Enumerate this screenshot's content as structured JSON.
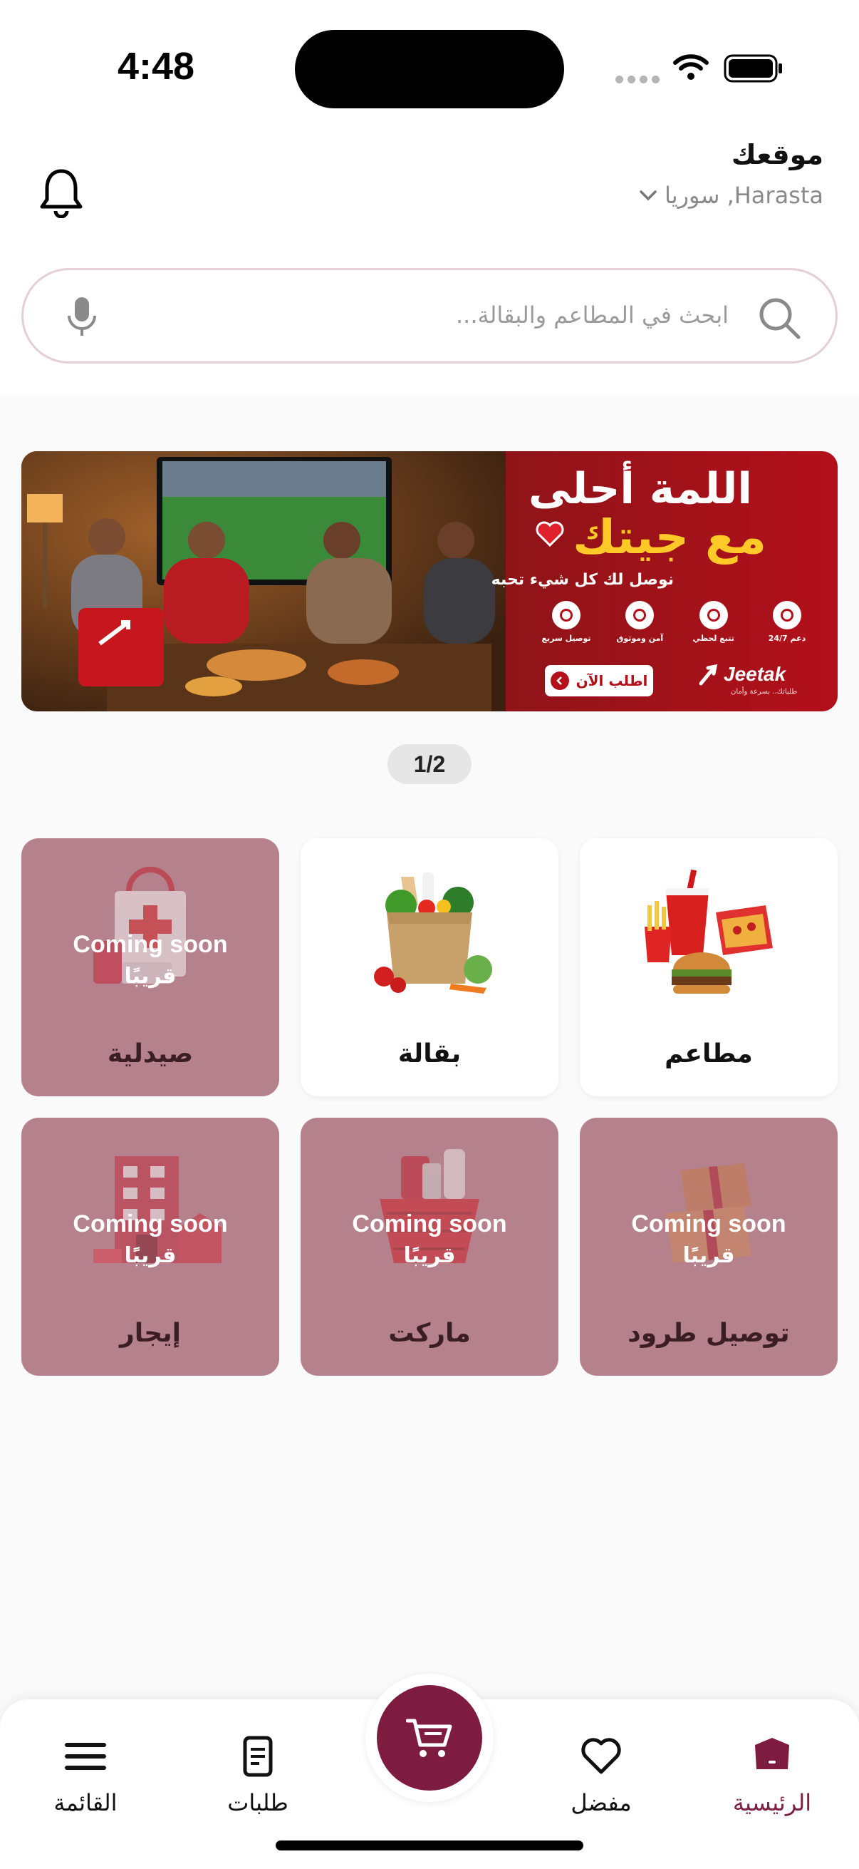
{
  "status_bar": {
    "time": "4:48"
  },
  "header": {
    "location_title": "موقعك",
    "location_value": "Harasta, سوريا"
  },
  "search": {
    "placeholder": "ابحث في المطاعم والبقالة..."
  },
  "banner": {
    "headline_line1": "اللمة أحلى",
    "headline_line2": "مع جيتك",
    "subtitle": "نوصل لك كل شيء تحبه",
    "features": [
      "دعم 24/7",
      "تتبع لحظي",
      "آمن وموثوق",
      "توصيل سريع"
    ],
    "cta_label": "اطلب الآن",
    "brand_name": "Jeetak",
    "brand_tagline": "طلباتك.. بسرعة وأمان"
  },
  "pager": {
    "text": "1/2"
  },
  "categories": [
    {
      "label": "مطاعم",
      "status": "active",
      "icon": "fast-food-icon"
    },
    {
      "label": "بقالة",
      "status": "active",
      "icon": "grocery-bag-icon"
    },
    {
      "label": "صيدلية",
      "status": "coming_soon",
      "icon": "pharmacy-bag-icon"
    },
    {
      "label": "توصيل طرود",
      "status": "coming_soon",
      "icon": "parcel-box-icon"
    },
    {
      "label": "ماركت",
      "status": "coming_soon",
      "icon": "market-basket-icon"
    },
    {
      "label": "إيجار",
      "status": "coming_soon",
      "icon": "building-icon"
    }
  ],
  "coming_soon": {
    "en": "Coming soon",
    "ar": "قريبًا"
  },
  "bottom_nav": {
    "home": "الرئيسية",
    "favorites": "مفضل",
    "orders": "طلبات",
    "menu": "القائمة"
  },
  "colors": {
    "brand": "#7e1c3f",
    "coming_soon_card": "#b5818d",
    "banner_red": "#b3101a",
    "banner_yellow": "#ffc928"
  }
}
